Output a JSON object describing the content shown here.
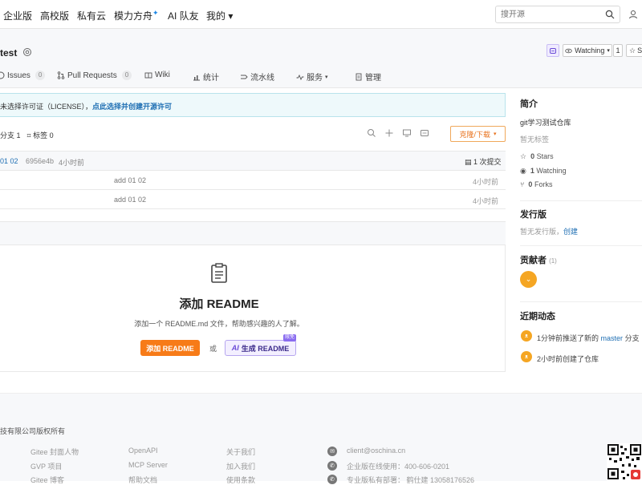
{
  "topnav": {
    "items": [
      "企业版",
      "高校版",
      "私有云",
      "模力方舟",
      "AI 队友",
      "我的 ▾"
    ],
    "star_mark": "✦",
    "search_placeholder": "搜开源"
  },
  "repo": {
    "name": "test",
    "watch_label": "Watching",
    "watch_count": "1",
    "star_label": "St"
  },
  "tabs": [
    {
      "label": "Issues",
      "count": "0"
    },
    {
      "label": "Pull Requests",
      "count": "0"
    },
    {
      "label": "Wiki"
    },
    {
      "label": "统计"
    },
    {
      "label": "流水线"
    },
    {
      "label": "服务"
    },
    {
      "label": "管理"
    }
  ],
  "license": {
    "text": "未选择许可证（LICENSE），",
    "link": "点此选择并创建开源许可"
  },
  "toolbar": {
    "branches": "分支 1",
    "tags": "标签 0",
    "clone_label": "克隆/下载"
  },
  "commit": {
    "message": "01 02",
    "hash": "6956e4b",
    "time": "4小时前",
    "count_label": "1 次提交"
  },
  "files": [
    {
      "message": "add 01 02",
      "time": "4小时前"
    },
    {
      "message": "add 01 02",
      "time": "4小时前"
    }
  ],
  "readme": {
    "title": "添加 README",
    "desc": "添加一个 README.md 文件，帮助感兴趣的人了解。",
    "add_button": "添加 README",
    "or": "或",
    "ai_button": "生成 README",
    "ai_prefix": "AI",
    "new_tag": "限免"
  },
  "sidebar": {
    "intro_title": "简介",
    "intro_desc": "git学习测试仓库",
    "no_tags": "暂无标签",
    "stars": "0",
    "stars_label": "Stars",
    "watching": "1",
    "watching_label": "Watching",
    "forks": "0",
    "forks_label": "Forks",
    "release_title": "发行版",
    "release_none": "暂无发行版，",
    "release_create": "创建",
    "contrib_title": "贡献者",
    "contrib_count": "(1)",
    "activity_title": "近期动态",
    "activities": [
      {
        "text": "1分钟前推送了新的",
        "branch": "master",
        "suffix": "分支"
      },
      {
        "text": "2小时前创建了仓库"
      }
    ]
  },
  "footer": {
    "copyright": "技有限公司版权所有",
    "col1": [
      "Gitee 封面人物",
      "GVP 项目",
      "Gitee 博客"
    ],
    "col2": [
      "OpenAPI",
      "MCP Server",
      "帮助文档"
    ],
    "col3": [
      "关于我们",
      "加入我们",
      "使用条款"
    ],
    "contacts": [
      "client@oschina.cn",
      "企业版在线使用：400-606-0201",
      "专业版私有部署：  鹤仕建 13058176526"
    ]
  },
  "colors": {
    "accent_orange": "#f77b18",
    "link_blue": "#1f6fb3",
    "ai_purple": "#6a4bd6"
  }
}
